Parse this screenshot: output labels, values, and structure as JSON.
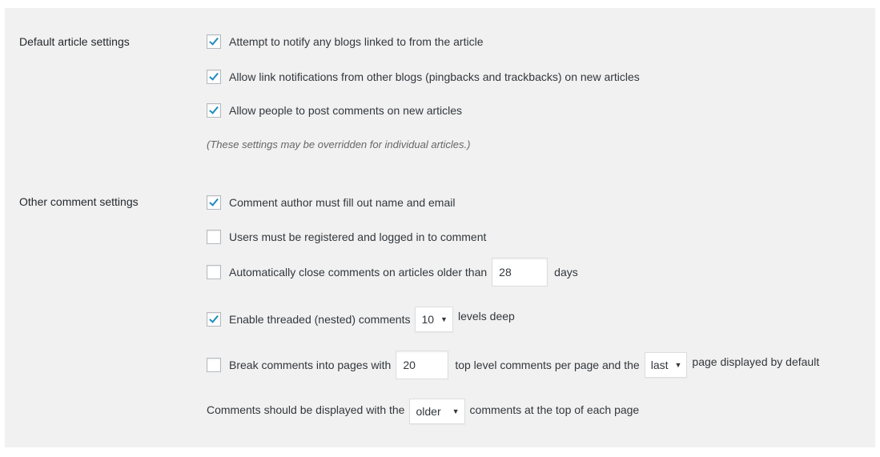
{
  "sections": {
    "default_article": {
      "label": "Default article settings",
      "options": [
        {
          "label": "Attempt to notify any blogs linked to from the article",
          "checked": true
        },
        {
          "label": "Allow link notifications from other blogs (pingbacks and trackbacks) on new articles",
          "checked": true
        },
        {
          "label": "Allow people to post comments on new articles",
          "checked": true
        }
      ],
      "note": "(These settings may be overridden for individual articles.)"
    },
    "other_comment": {
      "label": "Other comment settings",
      "require_name_email": {
        "label": "Comment author must fill out name and email",
        "checked": true
      },
      "registration_required": {
        "label": "Users must be registered and logged in to comment",
        "checked": false
      },
      "close_comments": {
        "label_before": "Automatically close comments on articles older than",
        "value": "28",
        "label_after": "days",
        "checked": false
      },
      "threaded": {
        "label_before": "Enable threaded (nested) comments",
        "select_value": "10",
        "label_after": "levels deep",
        "checked": true
      },
      "paginate": {
        "label_before": "Break comments into pages with",
        "per_page": "20",
        "label_middle": "top level comments per page and the",
        "select_value": "last",
        "label_after": "page displayed by default",
        "checked": false
      },
      "order": {
        "label_before": "Comments should be displayed with the",
        "select_value": "older",
        "label_after": "comments at the top of each page"
      }
    }
  },
  "colors": {
    "panel_bg": "#f1f1f1",
    "checkmark": "#1e8cbe"
  },
  "icons": {
    "checkmark": "checkmark-icon",
    "dropdown": "dropdown-arrow-icon"
  }
}
